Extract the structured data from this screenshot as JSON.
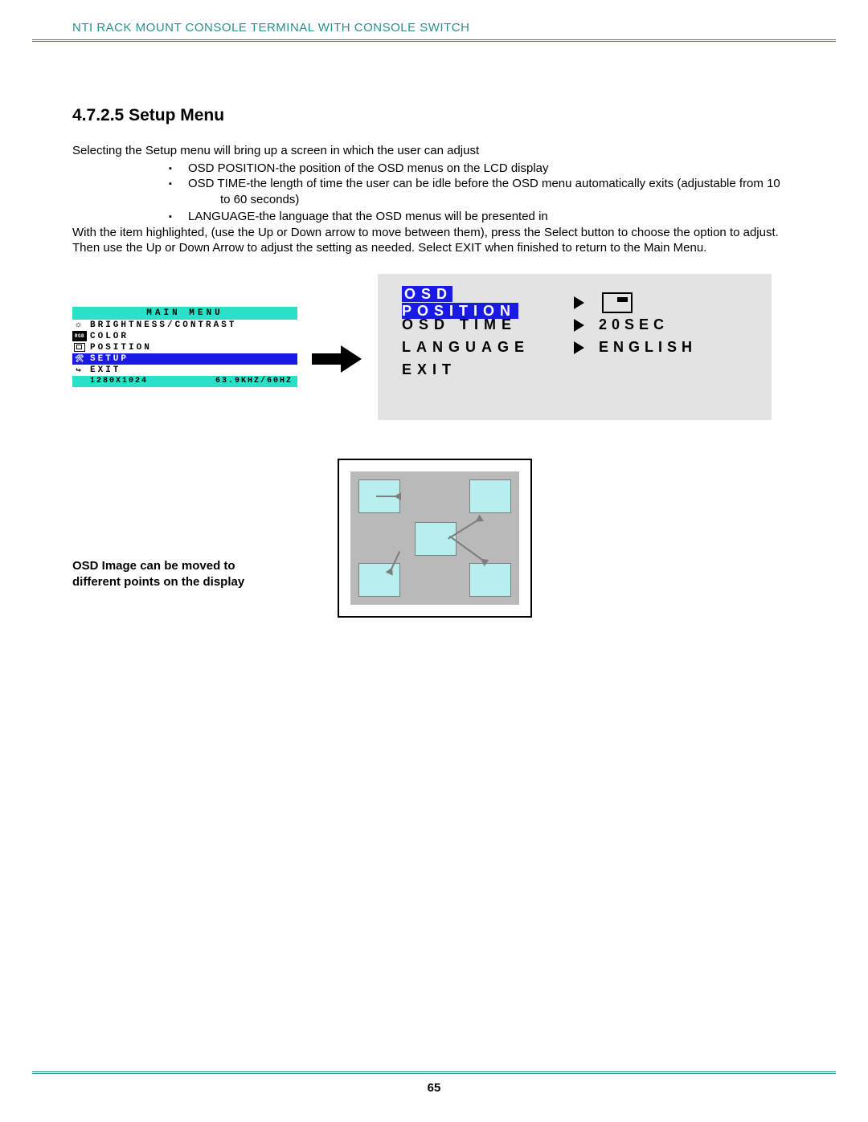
{
  "header": {
    "title": "NTI RACK MOUNT CONSOLE TERMINAL WITH CONSOLE SWITCH"
  },
  "section": {
    "number": "4.7.2.5",
    "title": "Setup Menu",
    "intro": "Selecting the Setup menu will bring up a screen in which the user can adjust",
    "bullet1": "OSD POSITION-the position of the OSD menus on the LCD display",
    "bullet2a": "OSD TIME-the length of time the user can be idle before the OSD menu automatically exits (adjustable from 10",
    "bullet2b": "to 60 seconds)",
    "bullet3": "LANGUAGE-the language that the OSD menus will be presented in",
    "para2": "With the item highlighted,   (use the Up or Down arrow to move between them),   press the Select button to choose the option to adjust.     Then use the Up or Down Arrow to adjust the setting as needed.    Select EXIT when finished to return to the Main Menu."
  },
  "main_menu": {
    "title": "MAIN  MENU",
    "items": [
      "BRIGHTNESS/CONTRAST",
      "COLOR",
      "POSITION",
      "SETUP",
      "EXIT"
    ],
    "footer_left": "1280X1024",
    "footer_right": "63.9KHZ/60HZ"
  },
  "setup_menu": {
    "rows": [
      {
        "label": "OSD  POSITION",
        "value_icon": "pos"
      },
      {
        "label": "OSD  TIME",
        "value": "20SEC"
      },
      {
        "label": "LANGUAGE",
        "value": "ENGLISH"
      },
      {
        "label": "EXIT",
        "value": ""
      }
    ]
  },
  "diagram_caption": "OSD Image can be moved to different points on the display",
  "page_number": "65"
}
